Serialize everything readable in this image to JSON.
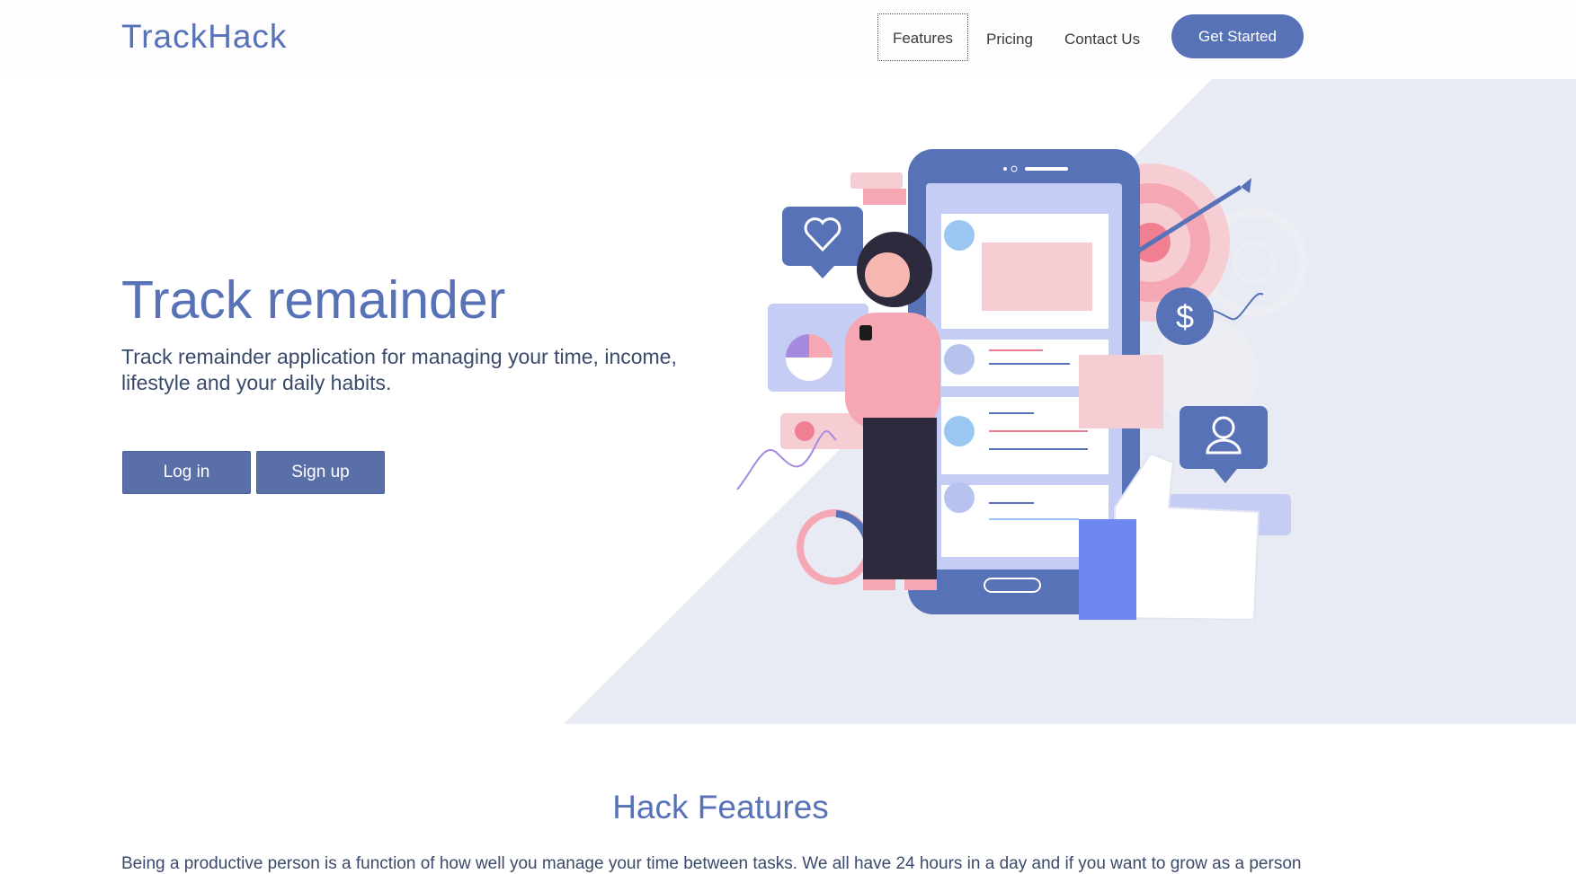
{
  "header": {
    "brand": "TrackHack",
    "nav": [
      "Features",
      "Pricing",
      "Contact Us"
    ],
    "cta": "Get Started"
  },
  "hero": {
    "title": "Track remainder",
    "subtitle": "Track remainder application for managing your time, income, lifestyle and your daily habits.",
    "login_label": "Log in",
    "signup_label": "Sign up",
    "illustration_dollar": "$"
  },
  "features": {
    "title": "Hack Features",
    "body": "Being a productive person is a function of how well you manage your time between tasks. We all have 24 hours in a day and if you want to grow as a person"
  },
  "colors": {
    "accent": "#5872b8",
    "background_panel": "#e8ebf3",
    "pink": "#f5a8b4",
    "button": "#5a6ea8"
  }
}
